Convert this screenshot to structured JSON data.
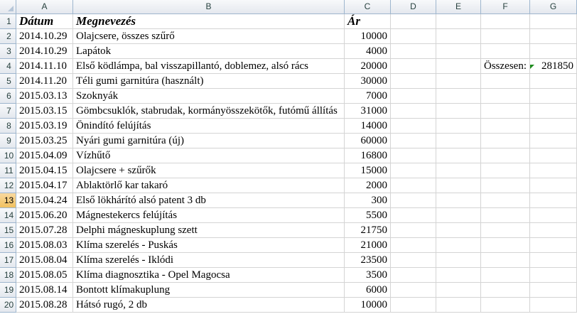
{
  "columns": [
    "A",
    "B",
    "C",
    "D",
    "E",
    "F",
    "G"
  ],
  "headers": {
    "date": "Dátum",
    "name": "Megnevezés",
    "price": "Ár"
  },
  "rows": [
    {
      "num": "1",
      "date": "",
      "name": "",
      "price": ""
    },
    {
      "num": "2",
      "date": "2014.10.29",
      "name": "Olajcsere, összes szűrő",
      "price": "10000"
    },
    {
      "num": "3",
      "date": "2014.10.29",
      "name": "Lapátok",
      "price": "4000"
    },
    {
      "num": "4",
      "date": "2014.11.10",
      "name": "Első ködlámpa, bal visszapillantó, doblemez, alsó rács",
      "price": "20000"
    },
    {
      "num": "5",
      "date": "2014.11.20",
      "name": "Téli gumi garnitúra (használt)",
      "price": "30000"
    },
    {
      "num": "6",
      "date": "2015.03.13",
      "name": "Szoknyák",
      "price": "7000"
    },
    {
      "num": "7",
      "date": "2015.03.15",
      "name": "Gömbcsuklók, stabrudak, kormányösszekötők, futómű állítás",
      "price": "31000"
    },
    {
      "num": "8",
      "date": "2015.03.19",
      "name": "Önindító felújítás",
      "price": "14000"
    },
    {
      "num": "9",
      "date": "2015.03.25",
      "name": "Nyári gumi garnitúra (új)",
      "price": "60000"
    },
    {
      "num": "10",
      "date": "2015.04.09",
      "name": "Vízhűtő",
      "price": "16800"
    },
    {
      "num": "11",
      "date": "2015.04.15",
      "name": "Olajcsere + szűrők",
      "price": "15000"
    },
    {
      "num": "12",
      "date": "2015.04.17",
      "name": "Ablaktörlő kar takaró",
      "price": "2000"
    },
    {
      "num": "13",
      "date": "2015.04.24",
      "name": "Első lökhárító alsó patent 3 db",
      "price": "300"
    },
    {
      "num": "14",
      "date": "2015.06.20",
      "name": "Mágnestekercs felújítás",
      "price": "5500"
    },
    {
      "num": "15",
      "date": "2015.07.28",
      "name": "Delphi mágneskuplung szett",
      "price": "21750"
    },
    {
      "num": "16",
      "date": "2015.08.03",
      "name": "Klíma szerelés - Puskás",
      "price": "21000"
    },
    {
      "num": "17",
      "date": "2015.08.04",
      "name": "Klíma szerelés - Iklódi",
      "price": "23500"
    },
    {
      "num": "18",
      "date": "2015.08.05",
      "name": "Klíma diagnosztika - Opel Magocsa",
      "price": "3500"
    },
    {
      "num": "19",
      "date": "2015.08.14",
      "name": "Bontott klímakuplung",
      "price": "6000"
    },
    {
      "num": "20",
      "date": "2015.08.28",
      "name": "Hátsó rugó, 2 db",
      "price": "10000"
    }
  ],
  "total": {
    "label": "Összesen:",
    "value": "281850"
  },
  "active_row": "13",
  "colors": {
    "header_bg": "#e4e8ee",
    "active_row_header": "#f1c15f",
    "comment_marker": "#1e8c1e",
    "gridline": "#d4d4d4"
  }
}
